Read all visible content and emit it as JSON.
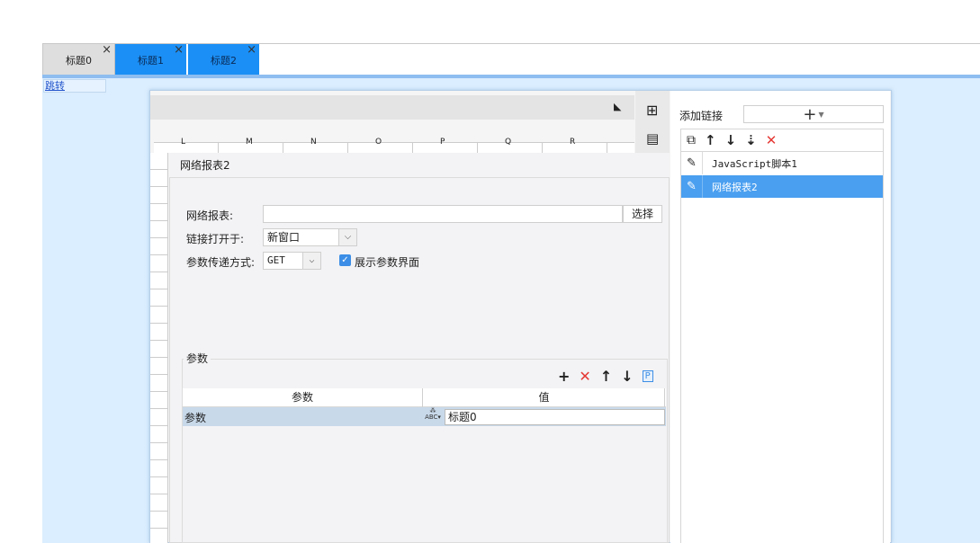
{
  "tabs": [
    {
      "label": "标题0",
      "close": "×"
    },
    {
      "label": "标题1",
      "close": "×"
    },
    {
      "label": "标题2",
      "close": "×"
    }
  ],
  "jump_link": "跳转",
  "sheet": {
    "column_headers": [
      "L",
      "M",
      "N",
      "O",
      "P",
      "Q",
      "R"
    ]
  },
  "right_panel": {
    "add_link_label": "添加链接",
    "add_button": "+",
    "items": [
      {
        "label": "JavaScript脚本1",
        "icon": "pencil-icon"
      },
      {
        "label": "网络报表2",
        "icon": "pencil-icon",
        "selected": true
      }
    ]
  },
  "form": {
    "title": "网络报表2",
    "report_label": "网络报表:",
    "report_value": "",
    "choose_button": "选择",
    "open_in_label": "链接打开于:",
    "open_in_value": "新窗口",
    "method_label": "参数传递方式:",
    "method_value": "GET",
    "show_params_label": "展示参数界面",
    "show_params_checked": true
  },
  "params": {
    "section_title": "参数",
    "columns": [
      "参数",
      "值"
    ],
    "rows": [
      {
        "name": "参数",
        "value": "标题0"
      }
    ]
  },
  "colors": {
    "accent_blue": "#1b8ff5",
    "selection": "#4a9ff0",
    "delete_red": "#e53935"
  }
}
